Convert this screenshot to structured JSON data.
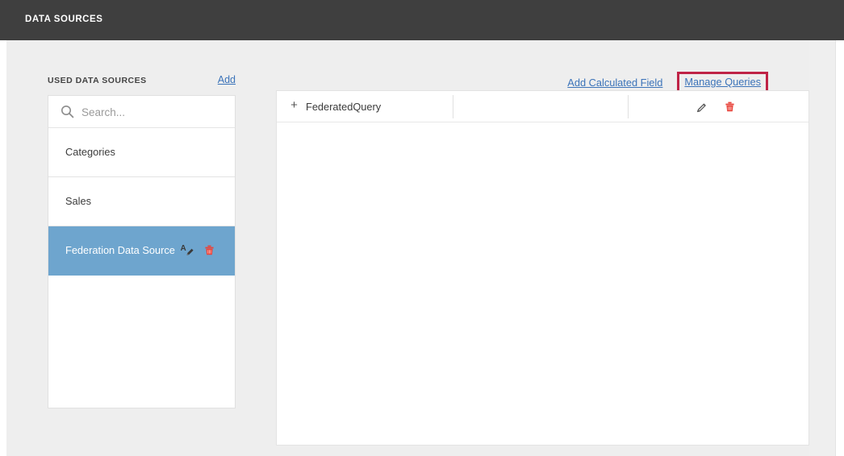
{
  "header": {
    "title": "DATA SOURCES"
  },
  "sidebar": {
    "caption": "USED DATA SOURCES",
    "add_label": "Add",
    "search": {
      "placeholder": "Search...",
      "value": "",
      "icon": "search-icon"
    },
    "items": [
      {
        "label": "Categories",
        "selected": false
      },
      {
        "label": "Sales",
        "selected": false
      },
      {
        "label": "Federation Data Source",
        "selected": true,
        "actions": [
          "rename-icon",
          "delete-icon"
        ]
      }
    ]
  },
  "content": {
    "add_calculated_field_label": "Add Calculated Field",
    "manage_queries_label": "Manage Queries",
    "highlight_color": "#bf2346",
    "query_table": {
      "rows": [
        {
          "expand_glyph": "+",
          "name": "FederatedQuery",
          "actions": [
            "edit-icon",
            "delete-icon"
          ]
        }
      ]
    }
  },
  "colors": {
    "header_bg": "#3f3f3f",
    "canvas_bg": "#eeeeee",
    "selection_blue": "#6ea5ce",
    "link_blue": "#3b73b9",
    "delete_red": "#e8453c"
  }
}
